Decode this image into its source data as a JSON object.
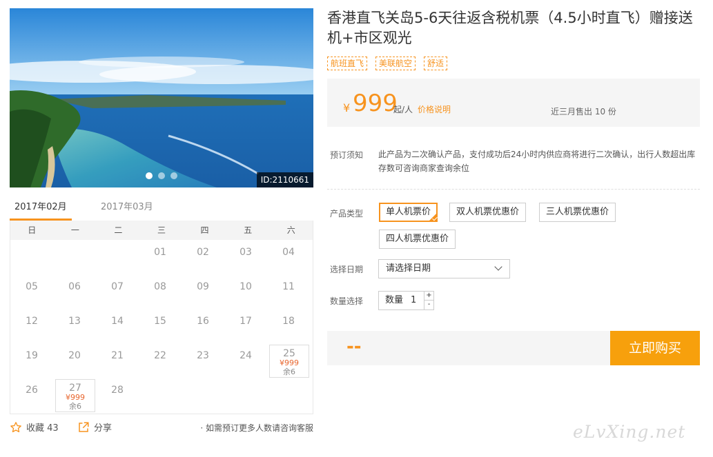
{
  "product": {
    "title": "香港直飞关岛5-6天往返含税机票（4.5小时直飞）赠接送机+市区观光",
    "tags": [
      "航班直飞",
      "美联航空",
      "舒适"
    ],
    "image_id": "ID:2110661"
  },
  "price": {
    "currency": "¥",
    "amount": "999",
    "unit": "起/人",
    "explain_link": "价格说明",
    "sold": "近三月售出 10 份"
  },
  "notice": {
    "label": "预订须知",
    "text": "此产品为二次确认产品，支付成功后24小时内供应商将进行二次确认，出行人数超出库存数可咨询商家查询余位"
  },
  "options": {
    "type_label": "产品类型",
    "types": [
      "单人机票价",
      "双人机票优惠价",
      "三人机票优惠价",
      "四人机票优惠价"
    ],
    "selected_index": 0,
    "date_label": "选择日期",
    "date_placeholder": "请选择日期",
    "qty_label": "数量选择",
    "qty_text": "数量",
    "qty_value": "1",
    "plus": "+",
    "minus": "-"
  },
  "buy": {
    "total": "--",
    "button": "立即购买"
  },
  "calendar": {
    "tabs": [
      "2017年02月",
      "2017年03月"
    ],
    "weekdays": [
      "日",
      "一",
      "二",
      "三",
      "四",
      "五",
      "六"
    ],
    "days": [
      {
        "d": "01",
        "col": 3,
        "row": 0
      },
      {
        "d": "02",
        "col": 4,
        "row": 0
      },
      {
        "d": "03",
        "col": 5,
        "row": 0
      },
      {
        "d": "04",
        "col": 6,
        "row": 0
      },
      {
        "d": "05",
        "col": 0,
        "row": 1
      },
      {
        "d": "06",
        "col": 1,
        "row": 1
      },
      {
        "d": "07",
        "col": 2,
        "row": 1
      },
      {
        "d": "08",
        "col": 3,
        "row": 1
      },
      {
        "d": "09",
        "col": 4,
        "row": 1
      },
      {
        "d": "10",
        "col": 5,
        "row": 1
      },
      {
        "d": "11",
        "col": 6,
        "row": 1
      },
      {
        "d": "12",
        "col": 0,
        "row": 2
      },
      {
        "d": "13",
        "col": 1,
        "row": 2
      },
      {
        "d": "14",
        "col": 2,
        "row": 2
      },
      {
        "d": "15",
        "col": 3,
        "row": 2
      },
      {
        "d": "16",
        "col": 4,
        "row": 2
      },
      {
        "d": "17",
        "col": 5,
        "row": 2
      },
      {
        "d": "18",
        "col": 6,
        "row": 2
      },
      {
        "d": "19",
        "col": 0,
        "row": 3
      },
      {
        "d": "20",
        "col": 1,
        "row": 3
      },
      {
        "d": "21",
        "col": 2,
        "row": 3
      },
      {
        "d": "22",
        "col": 3,
        "row": 3
      },
      {
        "d": "23",
        "col": 4,
        "row": 3
      },
      {
        "d": "24",
        "col": 5,
        "row": 3
      },
      {
        "d": "25",
        "col": 6,
        "row": 3,
        "price": "¥999",
        "remain": "余6"
      },
      {
        "d": "26",
        "col": 0,
        "row": 4
      },
      {
        "d": "27",
        "col": 1,
        "row": 4,
        "price": "¥999",
        "remain": "余6"
      },
      {
        "d": "28",
        "col": 2,
        "row": 4
      }
    ]
  },
  "actions": {
    "favorite": "收藏 43",
    "share": "分享",
    "note": "· 如需预订更多人数请咨询客服"
  },
  "watermark": "eLvXing.net",
  "colors": {
    "accent": "#f7931e",
    "buy_button": "#f7a00c",
    "calendar_price": "#e8662e"
  }
}
